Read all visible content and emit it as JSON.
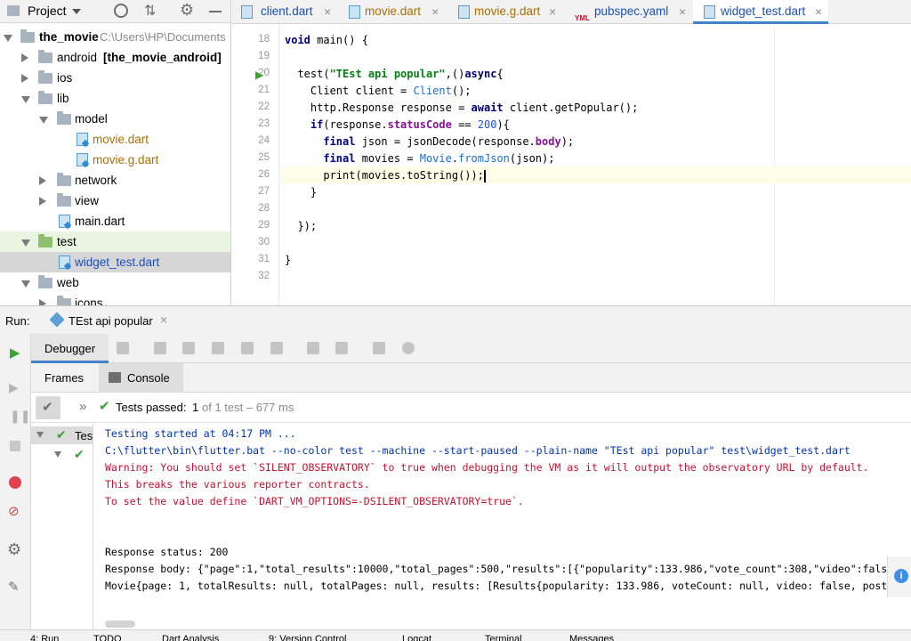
{
  "project": {
    "title": "Project",
    "tree": [
      {
        "label": "the_movie",
        "extra": "C:\\Users\\HP\\Documents"
      },
      {
        "label": "android",
        "extra": "[the_movie_android]"
      },
      {
        "label": "ios"
      },
      {
        "label": "lib"
      },
      {
        "label": "model"
      },
      {
        "label": "movie.dart"
      },
      {
        "label": "movie.g.dart"
      },
      {
        "label": "network"
      },
      {
        "label": "view"
      },
      {
        "label": "main.dart"
      },
      {
        "label": "test"
      },
      {
        "label": "widget_test.dart"
      },
      {
        "label": "web"
      },
      {
        "label": "icons"
      }
    ]
  },
  "editor": {
    "tabs": [
      {
        "label": "client.dart"
      },
      {
        "label": "movie.dart"
      },
      {
        "label": "movie.g.dart"
      },
      {
        "label": "pubspec.yaml",
        "icon_text": "YML"
      },
      {
        "label": "widget_test.dart"
      }
    ],
    "line_numbers": [
      "18",
      "19",
      "20",
      "21",
      "22",
      "23",
      "24",
      "25",
      "26",
      "27",
      "28",
      "29",
      "30",
      "31",
      "32"
    ]
  },
  "run": {
    "label": "Run:",
    "tab": "TEst api popular",
    "debugger_tab": "Debugger",
    "frames_tab": "Frames",
    "console_tab": "Console",
    "tests_passed_label": "Tests passed:",
    "tests_passed_count": "1",
    "tests_passed_rest": "of 1 test – 677 ms",
    "tree_item": "Tes",
    "console": [
      "Testing started at 04:17 PM ...",
      "C:\\flutter\\bin\\flutter.bat --no-color test --machine --start-paused --plain-name \"TEst api popular\" test\\widget_test.dart",
      "Warning: You should set `SILENT_OBSERVATORY` to true when debugging the VM as it will output the observatory URL by default.",
      "This breaks the various reporter contracts.",
      "To set the value define `DART_VM_OPTIONS=-DSILENT_OBSERVATORY=true`.",
      "Response status: 200",
      "Response body: {\"page\":1,\"total_results\":10000,\"total_pages\":500,\"results\":[{\"popularity\":133.986,\"vote_count\":308,\"video\":false",
      "Movie{page: 1, totalResults: null, totalPages: null, results: [Results{popularity: 133.986, voteCount: null, video: false, poste"
    ]
  },
  "status_bar": [
    {
      "label": "4: Run"
    },
    {
      "label": "TODO"
    },
    {
      "label": "Dart Analysis"
    },
    {
      "label": "9: Version Control"
    },
    {
      "label": "Logcat"
    },
    {
      "label": "Terminal"
    },
    {
      "label": "Messages"
    }
  ]
}
